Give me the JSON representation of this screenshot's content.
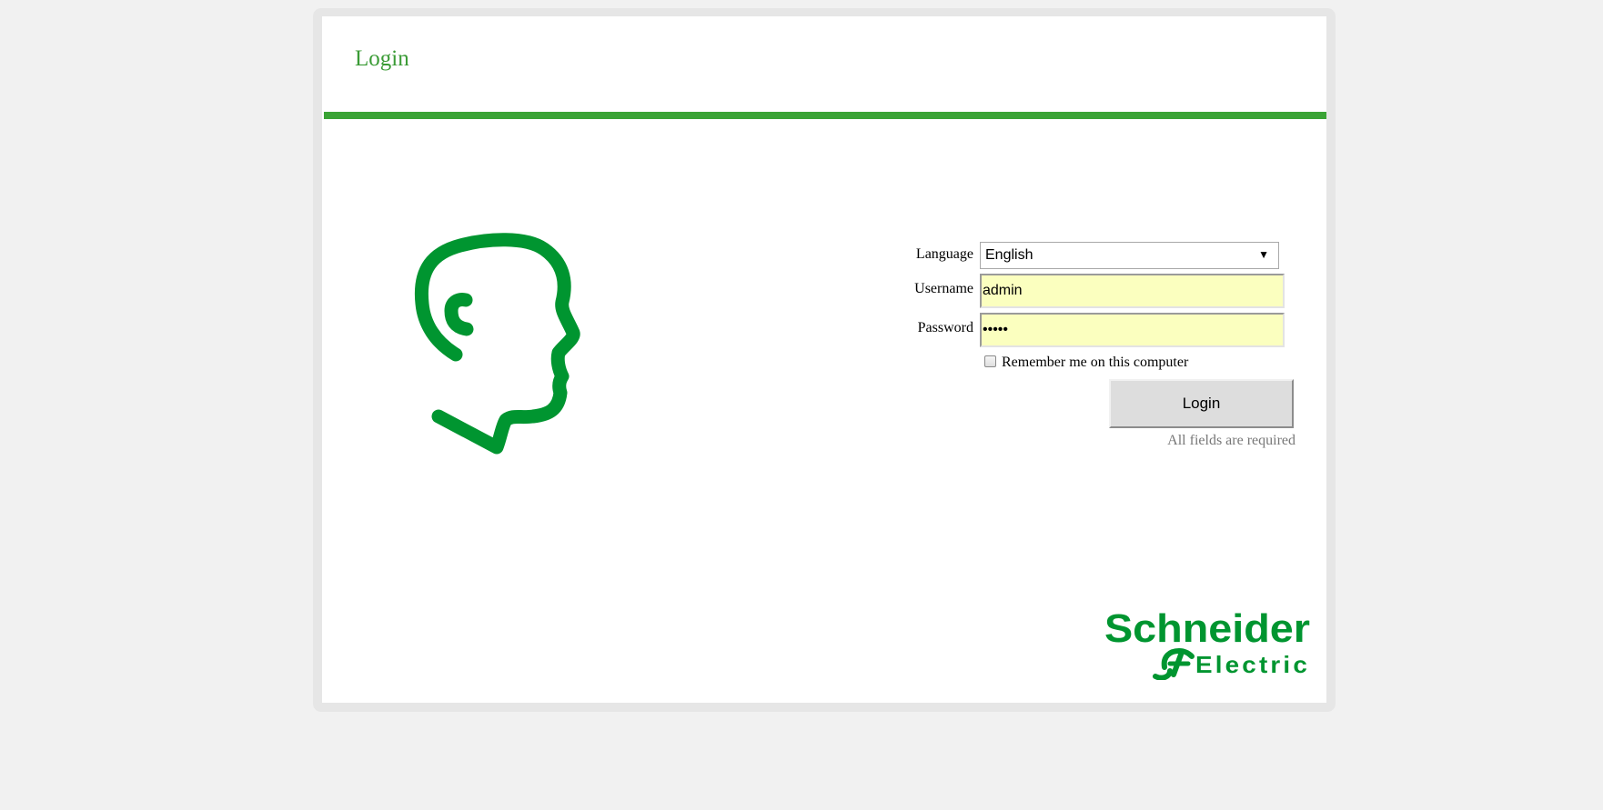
{
  "page": {
    "title": "Login"
  },
  "form": {
    "language_label": "Language",
    "language_value": "English",
    "username_label": "Username",
    "username_value": "admin",
    "password_label": "Password",
    "password_value": "•••••",
    "remember_label": "Remember me on this computer",
    "remember_checked": false,
    "login_button": "Login",
    "required_note": "All fields are required"
  },
  "brand": {
    "logo_text_line1": "Schneider",
    "logo_text_line2": "Electric"
  },
  "colors": {
    "accent": "#3aa335",
    "brand_green": "#009530",
    "field_bg": "#fbffbf",
    "page_bg": "#f1f1f1"
  },
  "icons": {
    "head_logo": "life-is-on-head-icon",
    "brand_logo": "schneider-electric-logo"
  }
}
